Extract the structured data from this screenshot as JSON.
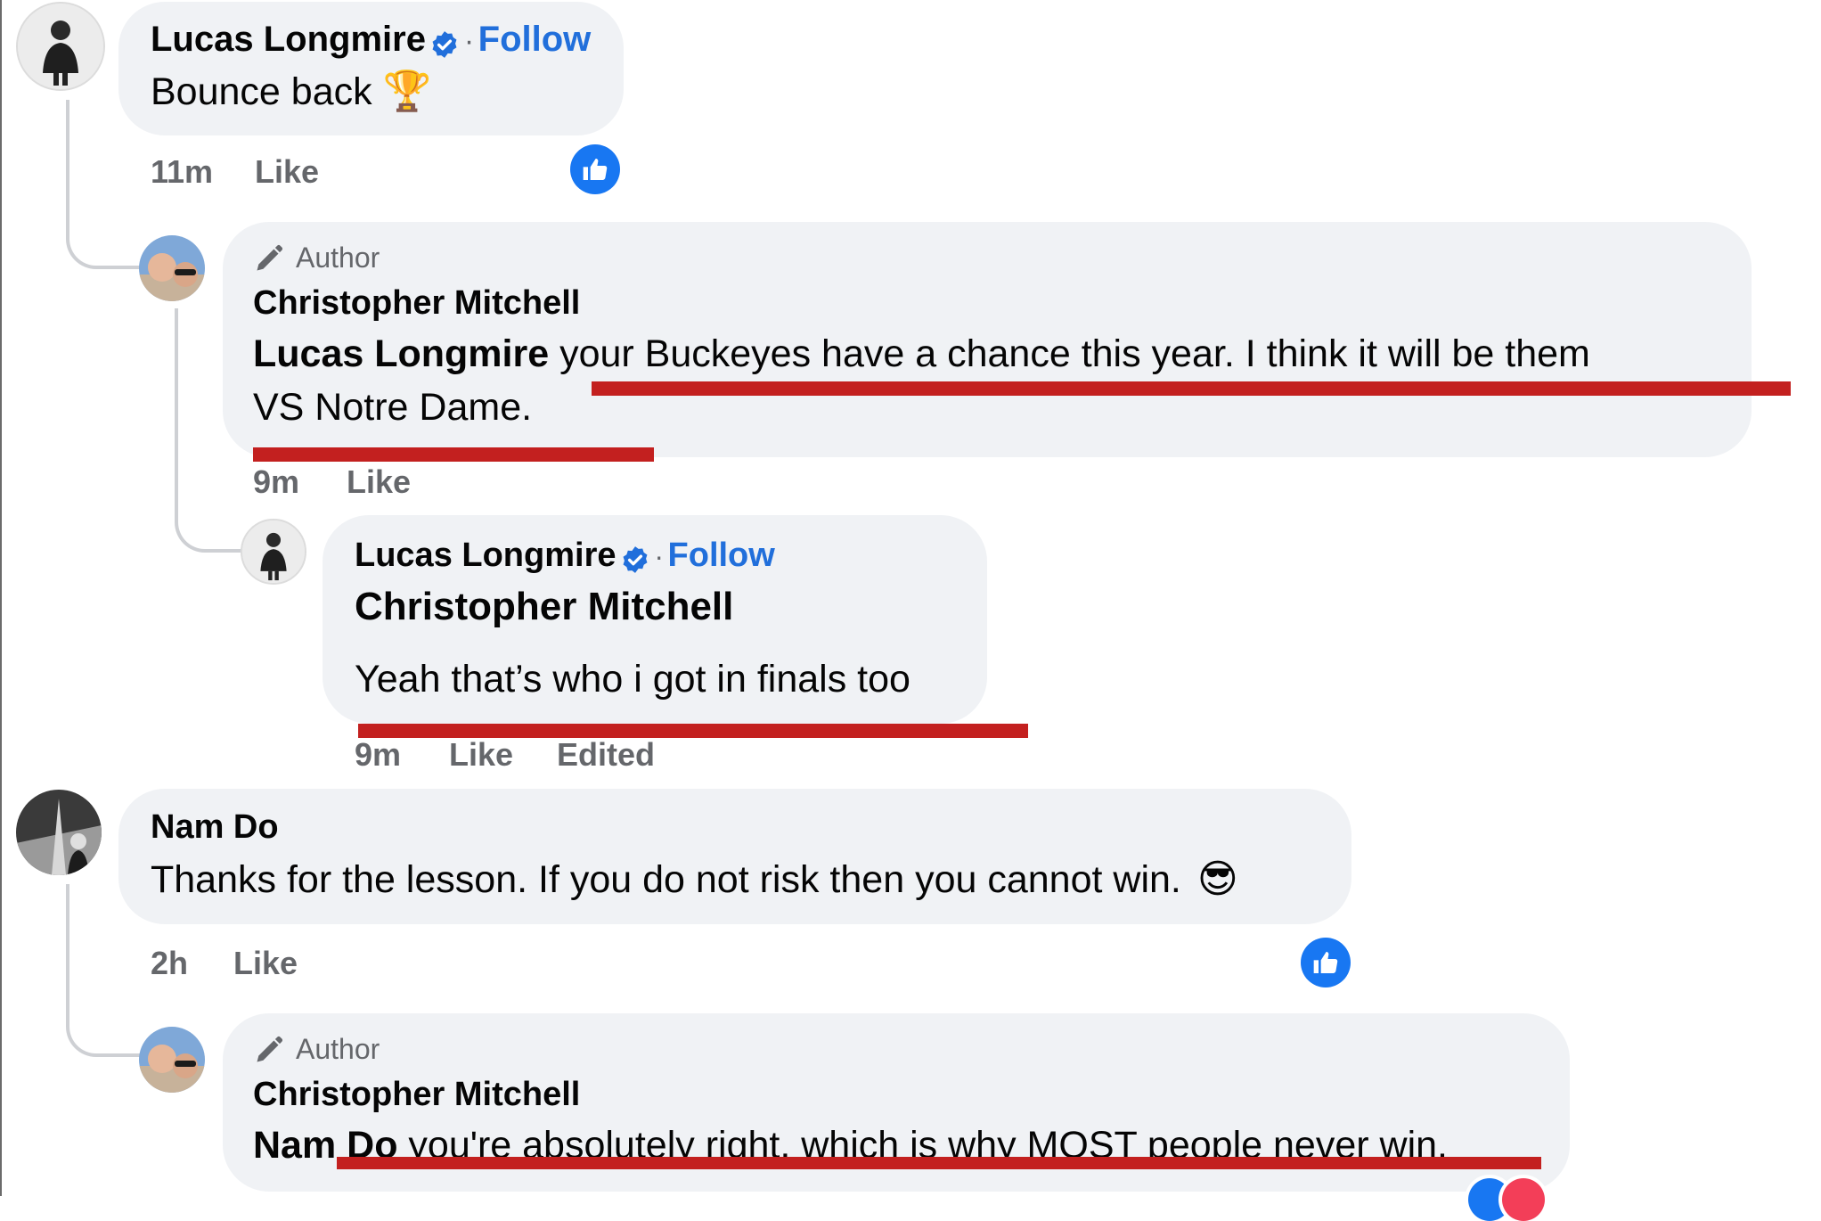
{
  "comments": [
    {
      "author": "Lucas Longmire",
      "follow": "Follow",
      "text": "Bounce back",
      "emoji": "🏆",
      "time": "11m",
      "like": "Like",
      "reaction": "like-reaction-icon",
      "replies": [
        {
          "badge": "Author",
          "author": "Christopher Mitchell",
          "mention": "Lucas Longmire",
          "text_line1": " your Buckeyes have a chance this year. I think it will be them",
          "text_line2": "VS Notre Dame.",
          "time": "9m",
          "like": "Like"
        },
        {
          "author": "Lucas Longmire",
          "follow": "Follow",
          "mention": "Christopher Mitchell",
          "text": "Yeah that’s who i got in finals too",
          "time": "9m",
          "like": "Like",
          "edited": "Edited"
        }
      ]
    },
    {
      "author": "Nam Do",
      "text": "Thanks for the lesson. If you do not risk then you cannot win.",
      "emoji": "😎",
      "time": "2h",
      "like": "Like",
      "reaction": "like-reaction-icon",
      "replies": [
        {
          "badge": "Author",
          "author": "Christopher Mitchell",
          "mention": "Nam Do",
          "text": " you're absolutely right, which is why MOST people never win."
        }
      ]
    }
  ],
  "separator": "·",
  "colors": {
    "link": "#216fdb",
    "bubble": "#f0f2f5",
    "meta": "#65676b",
    "like_badge": "#1877f2",
    "redline": "#c3201f"
  }
}
